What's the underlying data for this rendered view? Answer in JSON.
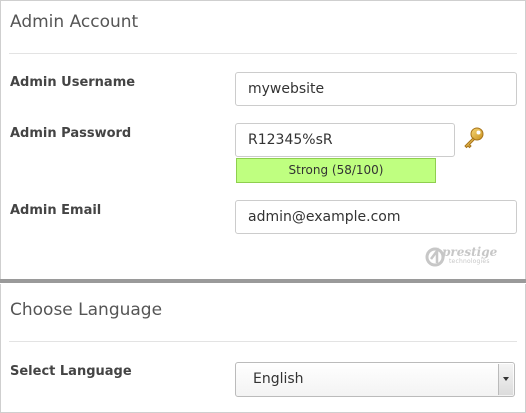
{
  "admin_account": {
    "title": "Admin Account",
    "username": {
      "label": "Admin Username",
      "value": "mywebsite"
    },
    "password": {
      "label": "Admin Password",
      "value": "R12345%sR",
      "strength_text": "Strong (58/100)",
      "strength_score": 58,
      "strength_max": 100,
      "strength_color": "#bfff80",
      "generate_icon": "key-icon"
    },
    "email": {
      "label": "Admin Email",
      "value": "admin@example.com"
    },
    "logo": {
      "name": "prestige",
      "tagline": "technologies"
    }
  },
  "language": {
    "title": "Choose Language",
    "select_label": "Select Language",
    "selected": "English"
  }
}
